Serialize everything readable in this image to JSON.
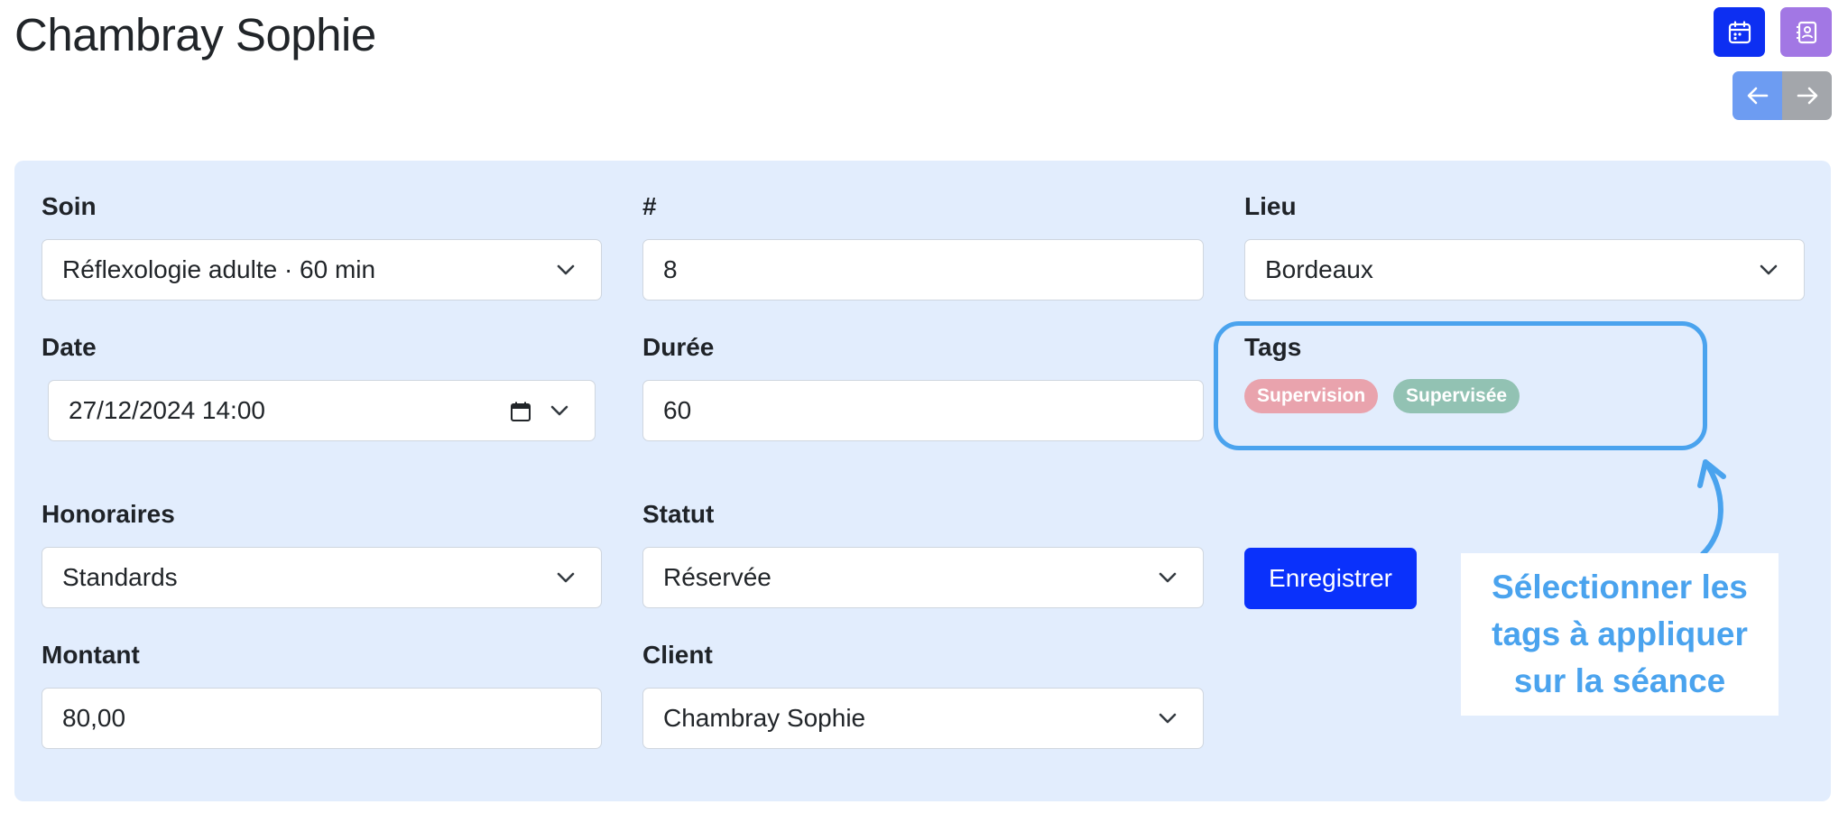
{
  "header": {
    "title": "Chambray Sophie",
    "calendar_icon": "calendar-icon",
    "contacts_icon": "contact-book-icon",
    "prev_icon": "arrow-left-icon",
    "next_icon": "arrow-right-icon"
  },
  "colors": {
    "panel_bg": "#e2edfd",
    "primary": "#0a31fb",
    "contacts_button": "#a277e4",
    "tag_supervision": "#e9a3ad",
    "tag_supervisee": "#92c2b3",
    "annotation": "#4aa3ee"
  },
  "form": {
    "soin": {
      "label": "Soin",
      "value": "Réflexologie adulte · 60 min"
    },
    "numero": {
      "label": "#",
      "value": "8"
    },
    "lieu": {
      "label": "Lieu",
      "value": "Bordeaux"
    },
    "date": {
      "label": "Date",
      "value": "27/12/2024 14:00"
    },
    "duree": {
      "label": "Durée",
      "value": "60"
    },
    "tags": {
      "label": "Tags",
      "items": [
        "Supervision",
        "Supervisée"
      ]
    },
    "honoraires": {
      "label": "Honoraires",
      "value": "Standards"
    },
    "statut": {
      "label": "Statut",
      "value": "Réservée"
    },
    "montant": {
      "label": "Montant",
      "value": "80,00"
    },
    "client": {
      "label": "Client",
      "value": "Chambray Sophie"
    },
    "save_label": "Enregistrer"
  },
  "annotation": {
    "text": "Sélectionner les tags à appliquer sur la séance"
  }
}
